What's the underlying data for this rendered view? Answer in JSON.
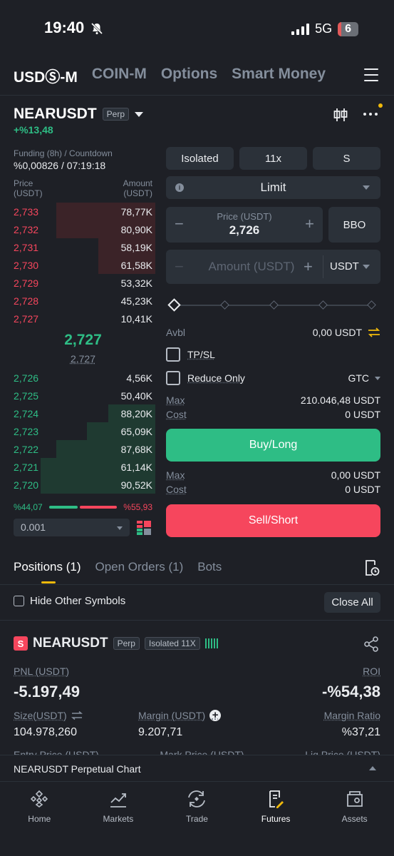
{
  "status": {
    "time": "19:40",
    "network": "5G",
    "battery": "6"
  },
  "top_tabs": [
    {
      "label": "USDⓈ-M",
      "active": true
    },
    {
      "label": "COIN-M",
      "active": false
    },
    {
      "label": "Options",
      "active": false
    },
    {
      "label": "Smart Money",
      "active": false
    }
  ],
  "symbol": {
    "name": "NEARUSDT",
    "type": "Perp",
    "change": "+%13,48"
  },
  "funding": {
    "label": "Funding (8h) / Countdown",
    "value": "%0,00826 / 07:19:18"
  },
  "orderbook": {
    "price_header": "Price\n(USDT)",
    "price_header_1": "Price",
    "price_header_2": "(USDT)",
    "amount_header_1": "Amount",
    "amount_header_2": "(USDT)",
    "asks": [
      {
        "price": "2,733",
        "amount": "78,77K",
        "depth": 0.7
      },
      {
        "price": "2,732",
        "amount": "80,90K",
        "depth": 0.7
      },
      {
        "price": "2,731",
        "amount": "58,19K",
        "depth": 0.4
      },
      {
        "price": "2,730",
        "amount": "61,58K",
        "depth": 0.4
      },
      {
        "price": "2,729",
        "amount": "53,32K",
        "depth": 0.0
      },
      {
        "price": "2,728",
        "amount": "45,23K",
        "depth": 0.0
      },
      {
        "price": "2,727",
        "amount": "10,41K",
        "depth": 0.0
      }
    ],
    "mid_price": "2,727",
    "mark_price": "2,727",
    "bids": [
      {
        "price": "2,726",
        "amount": "4,56K",
        "depth": 0.0
      },
      {
        "price": "2,725",
        "amount": "50,40K",
        "depth": 0.0
      },
      {
        "price": "2,724",
        "amount": "88,20K",
        "depth": 0.33
      },
      {
        "price": "2,723",
        "amount": "65,09K",
        "depth": 0.48
      },
      {
        "price": "2,722",
        "amount": "87,68K",
        "depth": 0.7
      },
      {
        "price": "2,721",
        "amount": "61,14K",
        "depth": 0.81
      },
      {
        "price": "2,720",
        "amount": "90,52K",
        "depth": 0.81
      }
    ],
    "buy_ratio": "%44,07",
    "sell_ratio": "%55,93",
    "buy_ratio_value": 44.07,
    "precision": "0.001"
  },
  "order_form": {
    "margin_mode": "Isolated",
    "leverage": "11x",
    "asset_mode": "S",
    "order_type": "Limit",
    "price_label": "Price (USDT)",
    "price_value": "2,726",
    "bbo": "BBO",
    "amount_placeholder": "Amount (USDT)",
    "amount_unit": "USDT",
    "avbl_label": "Avbl",
    "avbl_value": "0,00 USDT",
    "tpsl_label": "TP/SL",
    "reduce_only_label": "Reduce Only",
    "tif": "GTC",
    "buy_max_label": "Max",
    "buy_max_value": "210.046,48 USDT",
    "buy_cost_label": "Cost",
    "buy_cost_value": "0 USDT",
    "buy_label": "Buy/Long",
    "sell_max_label": "Max",
    "sell_max_value": "0,00 USDT",
    "sell_cost_label": "Cost",
    "sell_cost_value": "0 USDT",
    "sell_label": "Sell/Short"
  },
  "positions_tabs": [
    {
      "label": "Positions (1)",
      "active": true
    },
    {
      "label": "Open Orders (1)",
      "active": false
    },
    {
      "label": "Bots",
      "active": false
    }
  ],
  "hide_other_label": "Hide Other Symbols",
  "close_all_label": "Close All",
  "position": {
    "badge": "S",
    "symbol": "NEARUSDT",
    "type": "Perp",
    "margin": "Isolated 11X",
    "pnl_label": "PNL (USDT)",
    "pnl_value": "-5.197,49",
    "roi_label": "ROI",
    "roi_value": "-%54,38",
    "size_label": "Size(USDT)",
    "size_value": "104.978,260",
    "margin_label": "Margin (USDT)",
    "margin_value": "9.207,71",
    "margin_ratio_label": "Margin Ratio",
    "margin_ratio_value": "%37,21",
    "entry_label": "Entry Price (USDT)",
    "mark_label": "Mark Price (USDT)",
    "liq_label": "Liq.Price (USDT)"
  },
  "chart_bar_label": "NEARUSDT Perpetual Chart",
  "bottom_nav": [
    {
      "label": "Home",
      "icon": "home-icon",
      "active": false
    },
    {
      "label": "Markets",
      "icon": "markets-icon",
      "active": false
    },
    {
      "label": "Trade",
      "icon": "trade-icon",
      "active": false
    },
    {
      "label": "Futures",
      "icon": "futures-icon",
      "active": true
    },
    {
      "label": "Assets",
      "icon": "assets-icon",
      "active": false
    }
  ],
  "colors": {
    "green": "#2ebd85",
    "red": "#f6465d",
    "yellow": "#f0b90b",
    "background": "#1e2026"
  }
}
